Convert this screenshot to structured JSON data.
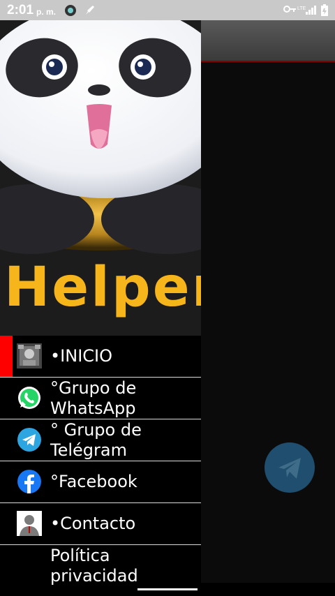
{
  "status_bar": {
    "time": "2:01",
    "ampm": "p. m."
  },
  "header": {
    "word": "Helper"
  },
  "menu": {
    "items": [
      {
        "label": "•INICIO",
        "icon": "home-thumbnail-icon",
        "active": true
      },
      {
        "label": "°Grupo de WhatsApp",
        "icon": "whatsapp-icon"
      },
      {
        "label": "° Grupo de Telégram",
        "icon": "telegram-icon"
      },
      {
        "label": "°Facebook",
        "icon": "facebook-icon"
      },
      {
        "label": "•Contacto",
        "icon": "contact-avatar-icon"
      },
      {
        "label": "Política privacidad",
        "icon": ""
      }
    ]
  },
  "colors": {
    "accent": "#f6b51a",
    "active_bar": "#ff0000",
    "fab": "#1f4e6e"
  }
}
